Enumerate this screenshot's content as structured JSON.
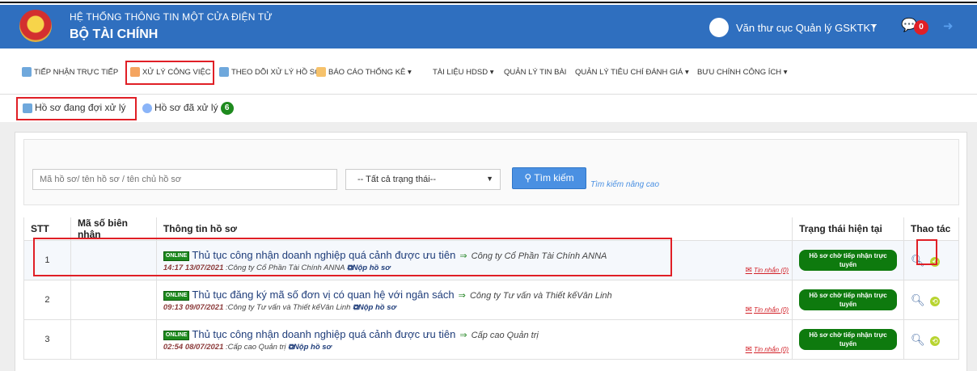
{
  "header": {
    "system_title": "HỆ THỐNG THÔNG TIN MỘT CỬA ĐIỆN TỬ",
    "org_name": "BỘ TÀI CHÍNH",
    "user_name": "Văn thư cục Quản lý GSKTKT",
    "user_caret": "▾",
    "notification_count": "0"
  },
  "menu": {
    "items": [
      {
        "label": "TIẾP NHẬN TRỰC TIẾP",
        "icon": "document-add-icon"
      },
      {
        "label": "XỬ LÝ CÔNG VIỆC",
        "icon": "list-icon"
      },
      {
        "label": "THEO DÕI XỬ LÝ HỒ SƠ",
        "icon": "search-doc-icon"
      },
      {
        "label": "BÁO CÁO THỐNG KÊ ▾",
        "icon": "report-icon"
      },
      {
        "label": "TÀI LIỆU HDSD ▾"
      },
      {
        "label": "QUẢN LÝ TIN BÀI"
      },
      {
        "label": "QUẢN LÝ TIÊU CHÍ ĐÁNH GIÁ ▾"
      },
      {
        "label": "BƯU CHÍNH CÔNG ÍCH ▾"
      }
    ]
  },
  "subtabs": {
    "pending_label": "Hồ sơ đang đợi xử lý",
    "done_label": "Hồ sơ đã xử lý",
    "done_count": "6"
  },
  "search": {
    "placeholder": "Mã hồ sơ/ tên hồ sơ / tên chủ hồ sơ",
    "status_selected": "-- Tất cả trạng thái--",
    "button_label": "Tìm kiếm",
    "advanced_link": "Tìm kiếm nâng cao"
  },
  "table": {
    "headers": {
      "stt": "STT",
      "code": "Mã số biên nhận",
      "info": "Thông tin hồ sơ",
      "state": "Trạng thái hiện tại",
      "actions": "Thao tác"
    },
    "online_tag": "ONLINE",
    "message_link": "Tin nhắn (0)",
    "rows": [
      {
        "stt": "1",
        "code": "",
        "procedure": "Thủ tục công nhận doanh nghiệp quá cảnh được ưu tiên",
        "company": "Công ty Cổ Phần Tài Chính ANNA",
        "time": "14:17 13/07/2021",
        "submitter": ":Công ty Cổ Phần Tài Chính ANNA",
        "action": "Nộp hồ sơ",
        "state": "Hồ sơ chờ tiếp nhận trực tuyến"
      },
      {
        "stt": "2",
        "code": "",
        "procedure": "Thủ tục đăng ký mã số đơn vị có quan hệ với ngân sách",
        "company": "Công ty Tư vấn và Thiết kếVân Linh",
        "time": "09:13 09/07/2021",
        "submitter": ":Công ty Tư vấn và Thiết kếVân Linh",
        "action": "Nộp hồ sơ",
        "state": "Hồ sơ chờ tiếp nhận trực tuyến"
      },
      {
        "stt": "3",
        "code": "",
        "procedure": "Thủ tục công nhận doanh nghiệp quá cảnh được ưu tiên",
        "company": "Cấp cao Quản trị",
        "time": "02:54 08/07/2021",
        "submitter": ":Cấp cao Quản trị",
        "action": "Nộp hồ sơ",
        "state": "Hồ sơ chờ tiếp nhận trực tuyến"
      }
    ]
  },
  "colors": {
    "header_bg": "#2f6fbf",
    "highlight": "#e01f26",
    "status_green": "#0e7a0e"
  }
}
